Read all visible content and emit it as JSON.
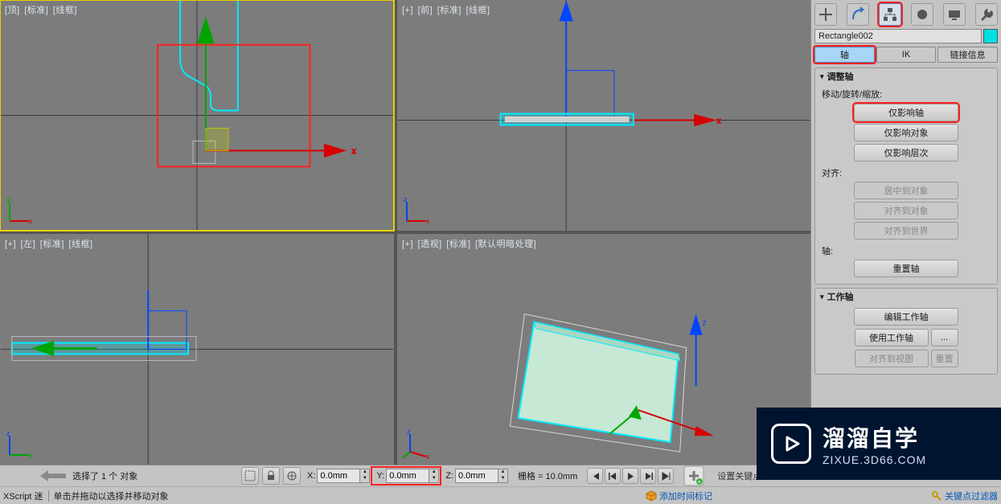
{
  "viewports": {
    "top": {
      "plus": "[+]",
      "name": "[顶]",
      "shade": "[标准]",
      "mode": "[线框]"
    },
    "front": {
      "plus": "[+]",
      "name": "[前]",
      "shade": "[标准]",
      "mode": "[线框]"
    },
    "left": {
      "plus": "[+]",
      "name": "[左]",
      "shade": "[标准]",
      "mode": "[线框]"
    },
    "persp": {
      "plus": "[+]",
      "name": "[透视]",
      "shade": "[标准]",
      "mode": "[默认明暗处理]"
    }
  },
  "panel": {
    "object_name": "Rectangle002",
    "tabs": {
      "pivot": "轴",
      "ik": "IK",
      "link": "链接信息"
    },
    "rollout_adjust": {
      "title": "调整轴",
      "move_label": "移动/旋转/缩放:",
      "affect_pivot": "仅影响轴",
      "affect_object": "仅影响对象",
      "affect_hierarchy": "仅影响层次",
      "align_label": "对齐:",
      "center_to_obj": "居中到对象",
      "align_to_obj": "对齐到对象",
      "align_to_world": "对齐到世界",
      "axis_label": "轴:",
      "reset_axis": "重置轴"
    },
    "rollout_working": {
      "title": "工作轴",
      "edit": "编辑工作轴",
      "use": "使用工作轴",
      "dots": "...",
      "align_view": "对齐到视图",
      "reset": "重置"
    }
  },
  "status": {
    "selected": "选择了 1 个 对象",
    "prompt_label": "XScript 迷",
    "prompt_hint": "单击并拖动以选择并移动对象",
    "X_label": "X:",
    "X_val": "0.0mm",
    "Y_label": "Y:",
    "Y_val": "0.0mm",
    "Z_label": "Z:",
    "Z_val": "0.0mm",
    "grid": "栅格 = 10.0mm",
    "add_time_tag": "添加时间标记",
    "set_key": "设置关键点",
    "key_filter": "关键点过滤器"
  },
  "watermark": {
    "title": "溜溜自学",
    "url": "ZIXUE.3D66.COM"
  }
}
